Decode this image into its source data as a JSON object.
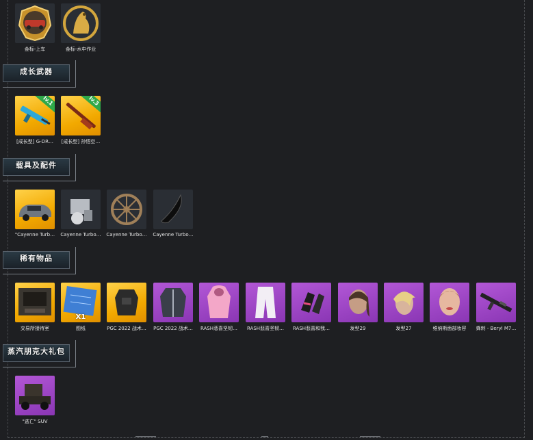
{
  "sections": [
    {
      "title": "成长武器"
    },
    {
      "title": "载具及配件"
    },
    {
      "title": "稀有物品"
    },
    {
      "title": "蒸汽朋克大礼包"
    }
  ],
  "top_items": [
    {
      "label": "金标-上车",
      "icon": "car-emblem-icon"
    },
    {
      "label": "金标-水中作业",
      "icon": "sea-lion-emblem-icon"
    }
  ],
  "weapons": [
    {
      "label": "[成长型] G-DR…",
      "badge": "lv.1",
      "icon": "rifle-icon"
    },
    {
      "label": "[成长型] 孙悟空…",
      "badge": "lv.3",
      "icon": "shotgun-icon"
    }
  ],
  "vehicles": [
    {
      "label": "\"Cayenne Turb…",
      "icon": "suv-car-icon"
    },
    {
      "label": "Cayenne Turbo…",
      "icon": "engine-part-icon"
    },
    {
      "label": "Cayenne Turbo…",
      "icon": "wheel-rim-icon"
    },
    {
      "label": "Cayenne Turbo…",
      "icon": "tail-light-icon"
    }
  ],
  "rare_items": [
    {
      "label": "交易所接待室",
      "icon": "room-icon",
      "bg": "gold"
    },
    {
      "label": "图纸",
      "icon": "blueprint-icon",
      "bg": "gold",
      "qty": "X1"
    },
    {
      "label": "PGC 2022 战术…",
      "icon": "vest-icon",
      "bg": "gold"
    },
    {
      "label": "PGC 2022 战术…",
      "icon": "coat-icon",
      "bg": "purple"
    },
    {
      "label": "RASH悲喜坚韧…",
      "icon": "pink-hoodie-icon",
      "bg": "purple"
    },
    {
      "label": "RASH悲喜坚韧…",
      "icon": "pants-icon",
      "bg": "purple"
    },
    {
      "label": "RASH悲喜和我…",
      "icon": "gloves-icon",
      "bg": "purple"
    },
    {
      "label": "发型29",
      "icon": "hair-ponytail-icon",
      "bg": "purple"
    },
    {
      "label": "发型27",
      "icon": "hair-blonde-icon",
      "bg": "purple"
    },
    {
      "label": "维纳斯面部妆容",
      "icon": "face-makeup-icon",
      "bg": "purple"
    },
    {
      "label": "蜂刺 - Beryl M7…",
      "icon": "beryl-rifle-icon",
      "bg": "purple"
    }
  ],
  "steampunk": [
    {
      "label": "\"逃亡\" SUV",
      "icon": "vintage-car-icon",
      "bg": "purple"
    }
  ]
}
